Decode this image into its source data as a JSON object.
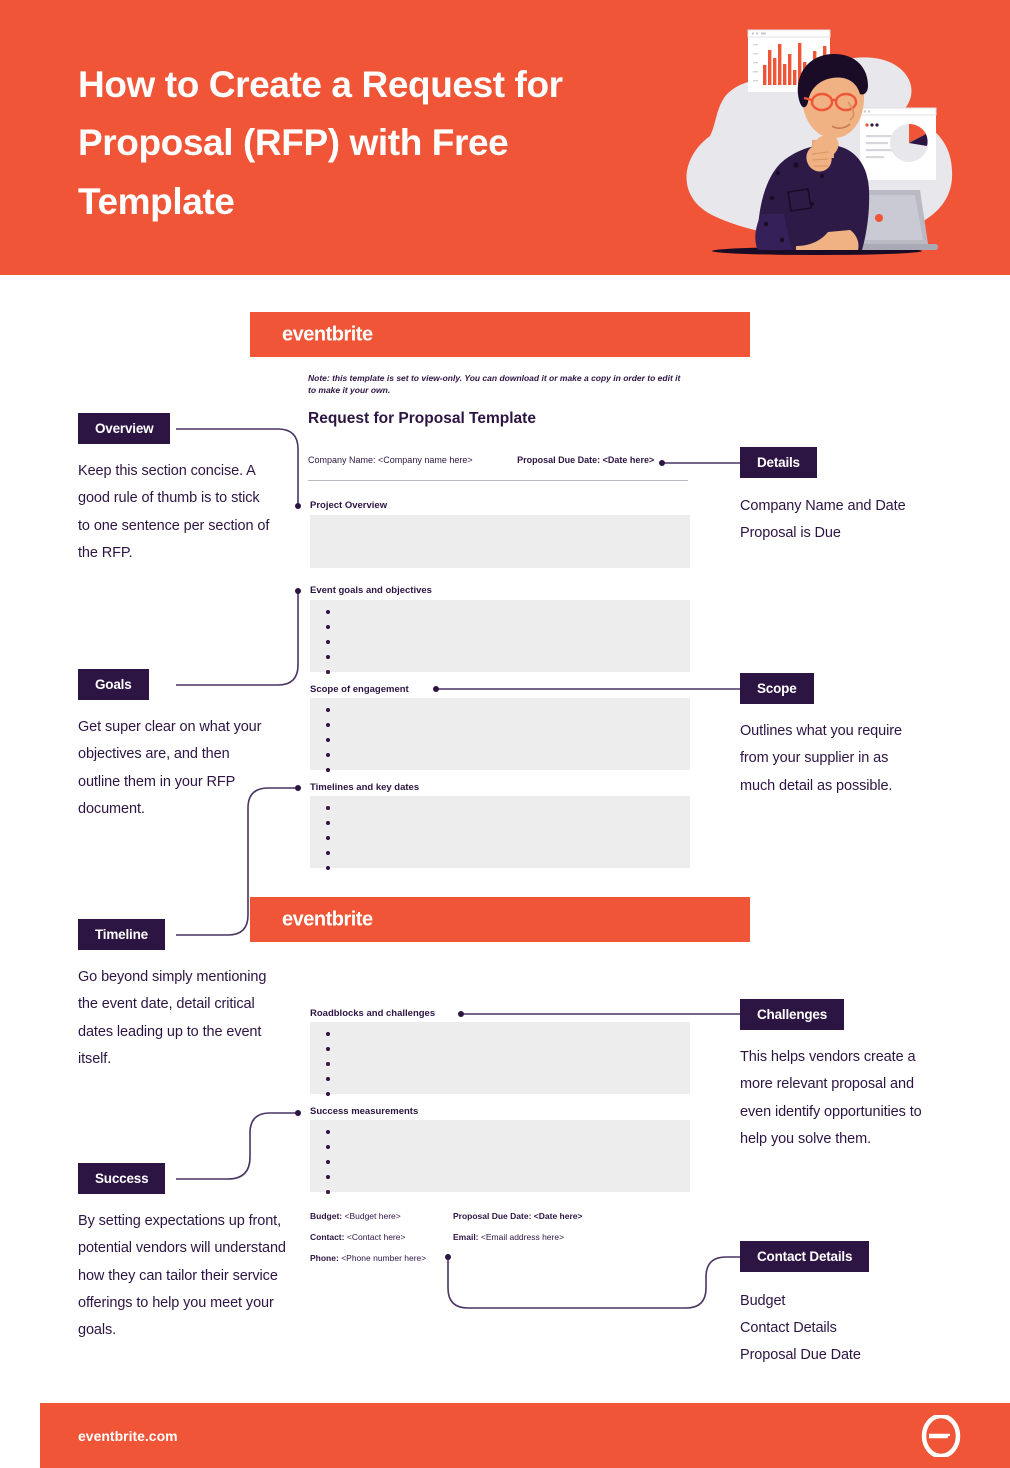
{
  "hero": {
    "title": "How to Create a Request for Proposal (RFP) with Free Template",
    "bg_color": "#F05537",
    "illustration": "person-at-laptop-with-charts-illustration"
  },
  "brand": {
    "orange": "#F05537",
    "purple": "#2D1543",
    "field_gray": "#EDEDED",
    "wordmark": "eventbrite"
  },
  "template": {
    "header_wordmark_top": "eventbrite",
    "header_wordmark_bottom": "eventbrite",
    "note": "Note: this template is set to view-only. You can download it or make a copy in order to edit it to make it your own.",
    "title": "Request for Proposal Template",
    "company_name_label": "Company Name:",
    "company_name_value": "<Company name here>",
    "due_date_label": "Proposal Due Date:",
    "due_date_value": "<Date here>",
    "fields": [
      {
        "label": "Project Overview",
        "bullets": 0
      },
      {
        "label": "Event goals and objectives",
        "bullets": 5
      },
      {
        "label": "Scope of engagement",
        "bullets": 5
      },
      {
        "label": "Timelines and key dates",
        "bullets": 5
      },
      {
        "label": "Roadblocks and challenges",
        "bullets": 5
      },
      {
        "label": "Success measurements",
        "bullets": 5
      }
    ],
    "contact": {
      "budget_label": "Budget:",
      "budget_value": "<Budget here>",
      "due_date_label": "Proposal Due Date:",
      "due_date_value": "<Date here>",
      "contact_label": "Contact:",
      "contact_value": "<Contact here>",
      "email_label": "Email:",
      "email_value": "<Email address here>",
      "phone_label": "Phone:",
      "phone_value": "<Phone number here>"
    }
  },
  "callouts": {
    "left": [
      {
        "badge": "Overview",
        "text": "Keep this section concise. A good rule of thumb is to stick to one sentence per section of the RFP."
      },
      {
        "badge": "Goals",
        "text": "Get super clear on what your objectives are, and then outline them in your RFP document."
      },
      {
        "badge": "Timeline",
        "text": "Go beyond simply mentioning the event date, detail critical dates leading up to the event itself."
      },
      {
        "badge": "Success",
        "text": "By setting expectations up front, potential vendors will understand how they can tailor their service offerings to help you meet your goals."
      }
    ],
    "right": [
      {
        "badge": "Details",
        "text": "Company Name and Date Proposal is Due"
      },
      {
        "badge": "Scope",
        "text": "Outlines what you require from your supplier in as much detail as possible."
      },
      {
        "badge": "Challenges",
        "text": "This helps vendors create a more relevant proposal and even identify opportunities to help you solve them."
      },
      {
        "badge": "Contact Details",
        "text": "Budget\nContact Details\nProposal Due Date"
      }
    ]
  },
  "footer": {
    "url": "eventbrite.com",
    "logo": "eventbrite-e-logo"
  }
}
